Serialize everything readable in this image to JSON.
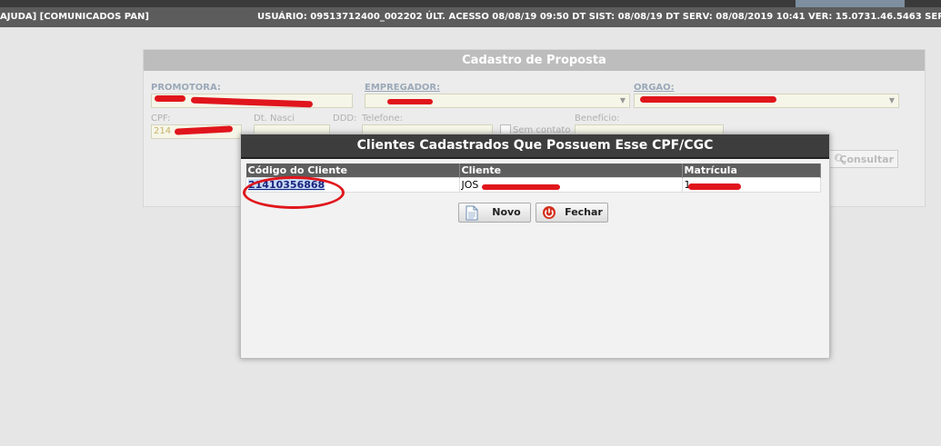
{
  "status_bar": {
    "left": "AJUDA] [COMUNICADOS PAN]",
    "right": "USUÁRIO: 09513712400_002202   ÚLT. ACESSO 08/08/19 09:50   DT SIST: 08/08/19   DT SERV: 08/08/2019 10:41   VER: 15.0731.46.5463   SER"
  },
  "form": {
    "title": "Cadastro de Proposta",
    "promotora_label": "PROMOTORA:",
    "empregador_label": "EMPREGADOR:",
    "orgao_label": "ORGAO:",
    "cpf_label": "CPF:",
    "cpf_value": "214",
    "dt_nasc_label": "Dt. Nasci",
    "ddd_label": "DDD:",
    "telefone_label": "Telefone:",
    "sem_contato_label": "Sem contato",
    "beneficio_label": "Benefício:",
    "consultar_label": "Consultar"
  },
  "modal": {
    "title": "Clientes Cadastrados Que Possuem Esse CPF/CGC",
    "columns": [
      "Código do Cliente",
      "Cliente",
      "Matrícula"
    ],
    "rows": [
      {
        "codigo": "21410356868",
        "cliente": "JOS",
        "matricula": "1"
      }
    ],
    "novo_label": "Novo",
    "fechar_label": "Fechar"
  },
  "colors": {
    "annotation_red": "#e0161c",
    "modal_header": "#3d3d3d",
    "table_header": "#5e5e5e",
    "link": "#1a237e"
  }
}
